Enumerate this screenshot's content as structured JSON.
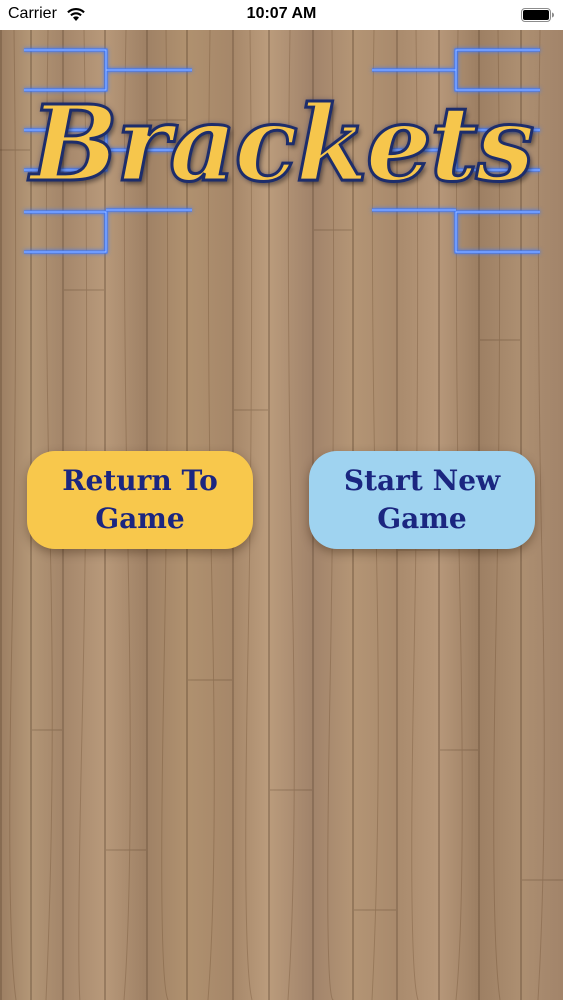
{
  "status_bar": {
    "carrier": "Carrier",
    "time": "10:07 AM",
    "icons": [
      "wifi-icon",
      "battery-icon"
    ]
  },
  "logo": {
    "text": "Brackets",
    "text_color": "#f6c64c",
    "outline_color": "#1d2d6b",
    "bracket_line_color": "#3a78ff"
  },
  "buttons": {
    "return_to_game": {
      "line1": "Return To",
      "line2": "Game",
      "color": "#f8c84c"
    },
    "start_new_game": {
      "line1": "Start New",
      "line2": "Game",
      "color": "#9fd3f0"
    }
  },
  "colors": {
    "button_text": "#1b2680",
    "wood": "#a88a6e"
  }
}
